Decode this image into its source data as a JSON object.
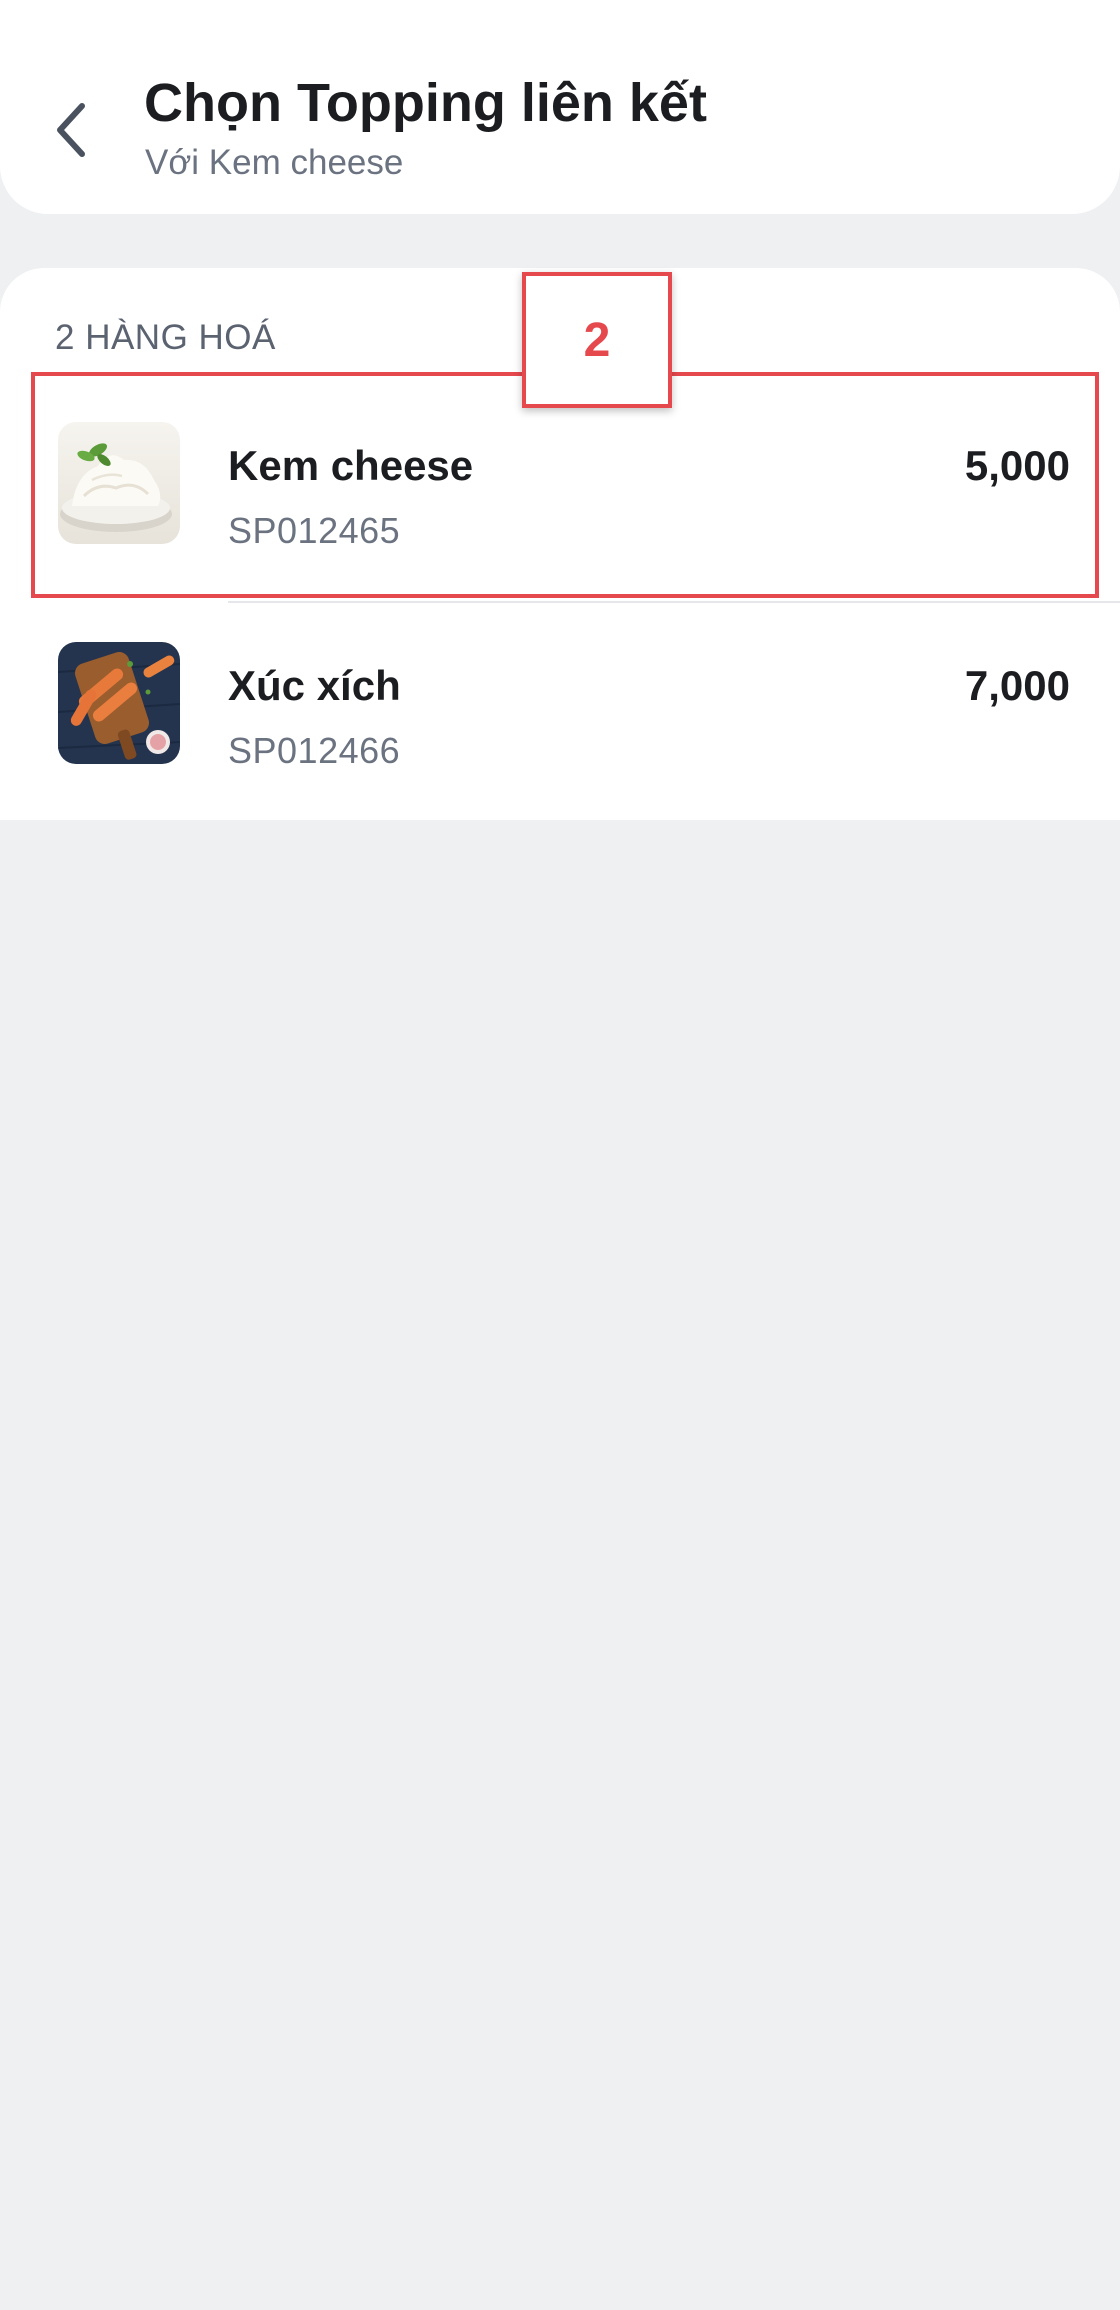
{
  "header": {
    "title": "Chọn Topping liên kết",
    "subtitle": "Với Kem cheese"
  },
  "list": {
    "section_label": "2 HÀNG HOÁ",
    "items": [
      {
        "name": "Kem cheese",
        "code": "SP012465",
        "price": "5,000",
        "image": "cream-cheese-thumbnail"
      },
      {
        "name": "Xúc xích",
        "code": "SP012466",
        "price": "7,000",
        "image": "sausage-thumbnail"
      }
    ]
  },
  "annotation": {
    "callout_label": "2",
    "color": "#e5484d"
  },
  "colors": {
    "background": "#eff0f2",
    "card": "#ffffff",
    "text_primary": "#1b1d21",
    "text_secondary": "#6b7280"
  }
}
